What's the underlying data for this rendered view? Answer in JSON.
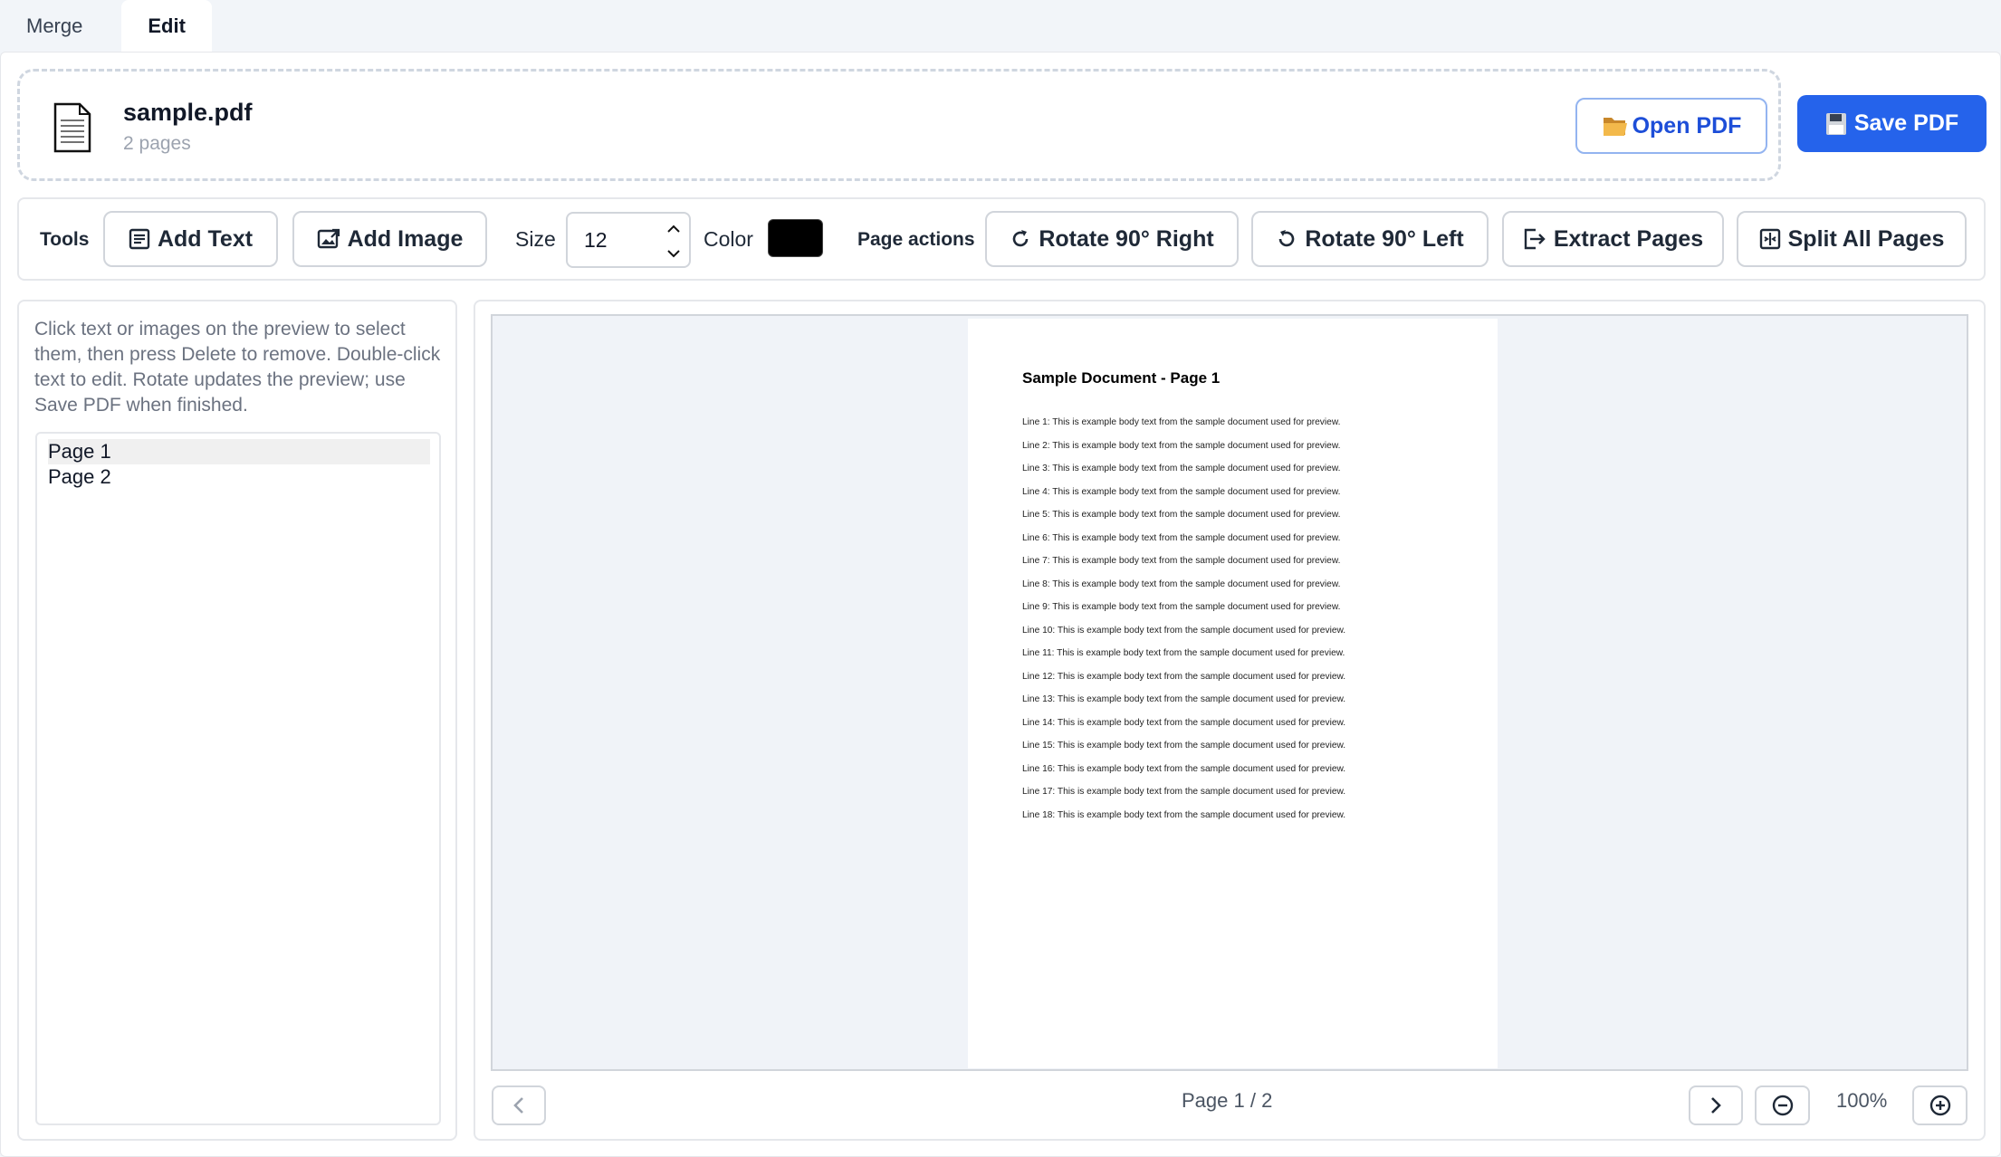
{
  "tabs": [
    {
      "label": "Merge",
      "active": false
    },
    {
      "label": "Edit",
      "active": true
    }
  ],
  "file": {
    "icon": "document-icon",
    "name": "sample.pdf",
    "pages": "2 pages",
    "open_label": "Open PDF",
    "open_icon": "folder-icon",
    "save_label": "Save PDF",
    "save_icon": "floppy-disk-icon"
  },
  "toolbar": {
    "tools_label": "Tools",
    "add_text_label": "Add Text",
    "add_image_label": "Add Image",
    "size_label": "Size",
    "size_value": "12",
    "color_label": "Color",
    "color_value": "#000000",
    "page_actions_label": "Page actions",
    "rotate_right_label": "Rotate 90° Right",
    "rotate_left_label": "Rotate 90° Left",
    "extract_label": "Extract Pages",
    "split_label": "Split All Pages"
  },
  "sidebar": {
    "hint": "Click text or images on the preview to select them, then press Delete to remove. Double-click text to edit. Rotate updates the preview; use Save PDF when finished.",
    "pages": [
      {
        "label": "Page 1",
        "selected": true
      },
      {
        "label": "Page 2",
        "selected": false
      }
    ]
  },
  "preview": {
    "doc_title": "Sample Document - Page 1",
    "lines": [
      "Line 1: This is example body text from the sample document used for preview.",
      "Line 2: This is example body text from the sample document used for preview.",
      "Line 3: This is example body text from the sample document used for preview.",
      "Line 4: This is example body text from the sample document used for preview.",
      "Line 5: This is example body text from the sample document used for preview.",
      "Line 6: This is example body text from the sample document used for preview.",
      "Line 7: This is example body text from the sample document used for preview.",
      "Line 8: This is example body text from the sample document used for preview.",
      "Line 9: This is example body text from the sample document used for preview.",
      "Line 10: This is example body text from the sample document used for preview.",
      "Line 11: This is example body text from the sample document used for preview.",
      "Line 12: This is example body text from the sample document used for preview.",
      "Line 13: This is example body text from the sample document used for preview.",
      "Line 14: This is example body text from the sample document used for preview.",
      "Line 15: This is example body text from the sample document used for preview.",
      "Line 16: This is example body text from the sample document used for preview.",
      "Line 17: This is example body text from the sample document used for preview.",
      "Line 18: This is example body text from the sample document used for preview."
    ],
    "page_indicator": "Page 1 / 2",
    "zoom": "100%"
  },
  "colors": {
    "accent": "#2563eb",
    "page_bg": "#f2f5f9",
    "border": "#e5e7eb"
  }
}
